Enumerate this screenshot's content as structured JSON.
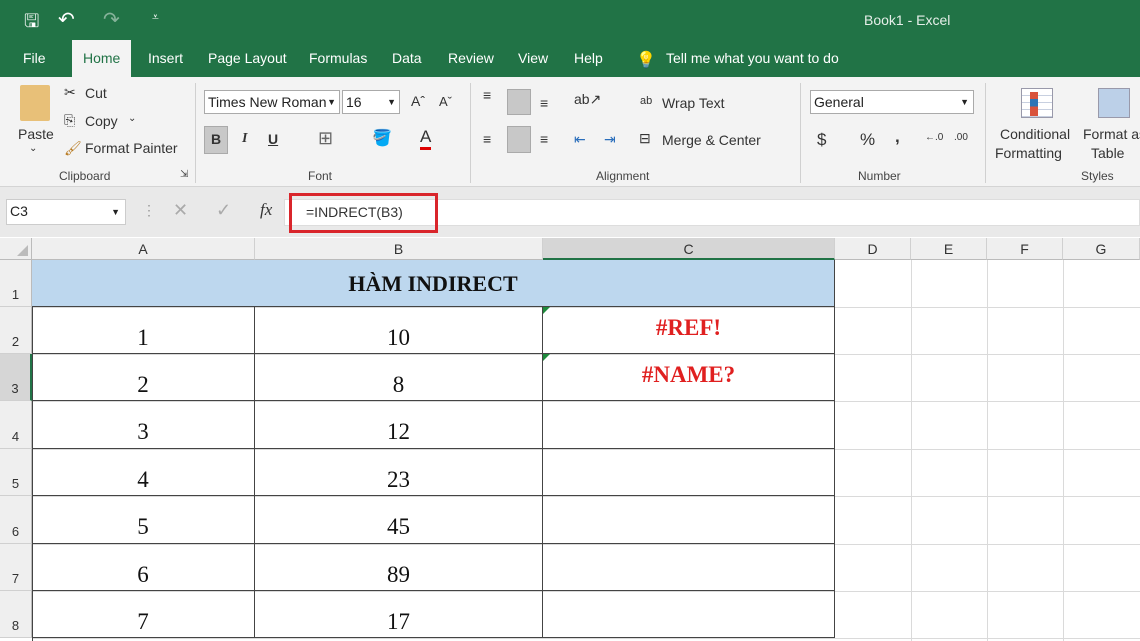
{
  "title": "Book1  -  Excel",
  "tabs": [
    "File",
    "Home",
    "Insert",
    "Page Layout",
    "Formulas",
    "Data",
    "Review",
    "View",
    "Help"
  ],
  "tell_me": "Tell me what you want to do",
  "clipboard": {
    "paste": "Paste",
    "cut": "Cut",
    "copy": "Copy",
    "format_painter": "Format Painter",
    "label": "Clipboard"
  },
  "font": {
    "name": "Times New Roman",
    "size": "16",
    "bold": "B",
    "italic": "I",
    "underline": "U",
    "label": "Font"
  },
  "alignment": {
    "wrap": "Wrap Text",
    "merge": "Merge & Center",
    "label": "Alignment"
  },
  "number": {
    "format": "General",
    "currency": "$",
    "percent": "%",
    "comma": ",",
    "label": "Number"
  },
  "styles": {
    "conditional1": "Conditional",
    "conditional2": "Formatting",
    "format1": "Format as",
    "format2": "Table",
    "label": "Styles"
  },
  "formula_bar": {
    "name_box": "C3",
    "fx": "fx",
    "formula": "=INDRECT(B3)",
    "highlight_color": "#d9252b"
  },
  "columns": [
    "A",
    "B",
    "C",
    "D",
    "E",
    "F",
    "G"
  ],
  "rows": [
    "1",
    "2",
    "3",
    "4",
    "5",
    "6",
    "7",
    "8"
  ],
  "sheet": {
    "header": "HÀM INDIRECT",
    "header_fill": "#bdd7ee",
    "data": [
      [
        "1",
        "10",
        "#REF!"
      ],
      [
        "2",
        "8",
        "#NAME?"
      ],
      [
        "3",
        "12",
        ""
      ],
      [
        "4",
        "23",
        ""
      ],
      [
        "5",
        "45",
        ""
      ],
      [
        "6",
        "89",
        ""
      ],
      [
        "7",
        "17",
        ""
      ]
    ],
    "error_color": "#e02020"
  }
}
